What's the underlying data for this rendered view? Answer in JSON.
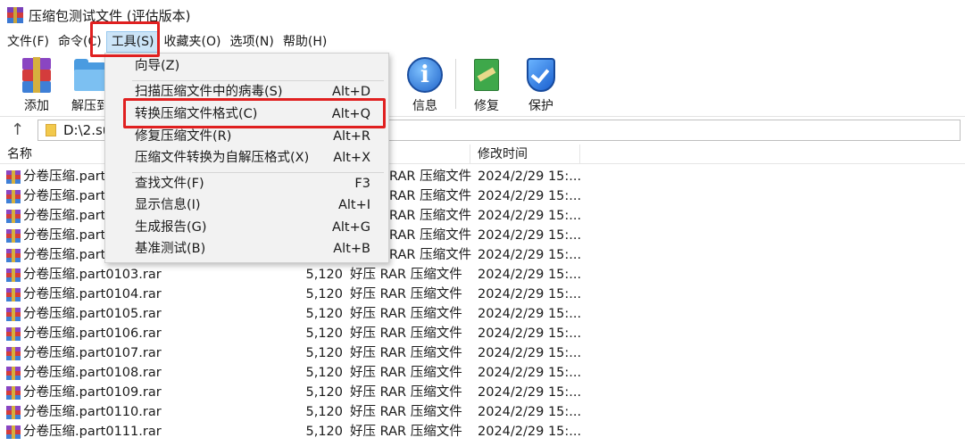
{
  "window": {
    "title": "压缩包测试文件 (评估版本)"
  },
  "menubar": {
    "items": [
      "文件(F)",
      "命令(C)",
      "工具(S)",
      "收藏夹(O)",
      "选项(N)",
      "帮助(H)"
    ],
    "active": "工具(S)"
  },
  "toolbar": {
    "add": "添加",
    "extract": "解压到",
    "info": "信息",
    "repair": "修复",
    "protect": "保护"
  },
  "address": {
    "path": "D:\\2.su"
  },
  "columns": {
    "name": "名称",
    "modified": "修改时间"
  },
  "tools_menu": {
    "items": [
      {
        "label": "向导(Z)",
        "shortcut": ""
      },
      {
        "label": "扫描压缩文件中的病毒(S)",
        "shortcut": "Alt+D"
      },
      {
        "label": "转换压缩文件格式(C)",
        "shortcut": "Alt+Q"
      },
      {
        "label": "修复压缩文件(R)",
        "shortcut": "Alt+R"
      },
      {
        "label": "压缩文件转换为自解压格式(X)",
        "shortcut": "Alt+X"
      },
      {
        "label": "查找文件(F)",
        "shortcut": "F3"
      },
      {
        "label": "显示信息(I)",
        "shortcut": "Alt+I"
      },
      {
        "label": "生成报告(G)",
        "shortcut": "Alt+G"
      },
      {
        "label": "基准测试(B)",
        "shortcut": "Alt+B"
      }
    ]
  },
  "files": [
    {
      "name": "分卷压缩.part0",
      "size": "",
      "type": "RAR 压缩文件",
      "modified": "2024/2/29 15:..."
    },
    {
      "name": "分卷压缩.part0",
      "size": "",
      "type": "RAR 压缩文件",
      "modified": "2024/2/29 15:..."
    },
    {
      "name": "分卷压缩.part0",
      "size": "",
      "type": "RAR 压缩文件",
      "modified": "2024/2/29 15:..."
    },
    {
      "name": "分卷压缩.part0",
      "size": "",
      "type": "RAR 压缩文件",
      "modified": "2024/2/29 15:..."
    },
    {
      "name": "分卷压缩.part0",
      "size": "",
      "type": "RAR 压缩文件",
      "modified": "2024/2/29 15:..."
    },
    {
      "name": "分卷压缩.part0103.rar",
      "size": "5,120",
      "type": "好压 RAR 压缩文件",
      "modified": "2024/2/29 15:..."
    },
    {
      "name": "分卷压缩.part0104.rar",
      "size": "5,120",
      "type": "好压 RAR 压缩文件",
      "modified": "2024/2/29 15:..."
    },
    {
      "name": "分卷压缩.part0105.rar",
      "size": "5,120",
      "type": "好压 RAR 压缩文件",
      "modified": "2024/2/29 15:..."
    },
    {
      "name": "分卷压缩.part0106.rar",
      "size": "5,120",
      "type": "好压 RAR 压缩文件",
      "modified": "2024/2/29 15:..."
    },
    {
      "name": "分卷压缩.part0107.rar",
      "size": "5,120",
      "type": "好压 RAR 压缩文件",
      "modified": "2024/2/29 15:..."
    },
    {
      "name": "分卷压缩.part0108.rar",
      "size": "5,120",
      "type": "好压 RAR 压缩文件",
      "modified": "2024/2/29 15:..."
    },
    {
      "name": "分卷压缩.part0109.rar",
      "size": "5,120",
      "type": "好压 RAR 压缩文件",
      "modified": "2024/2/29 15:..."
    },
    {
      "name": "分卷压缩.part0110.rar",
      "size": "5,120",
      "type": "好压 RAR 压缩文件",
      "modified": "2024/2/29 15:..."
    },
    {
      "name": "分卷压缩.part0111.rar",
      "size": "5,120",
      "type": "好压 RAR 压缩文件",
      "modified": "2024/2/29 15:..."
    }
  ]
}
